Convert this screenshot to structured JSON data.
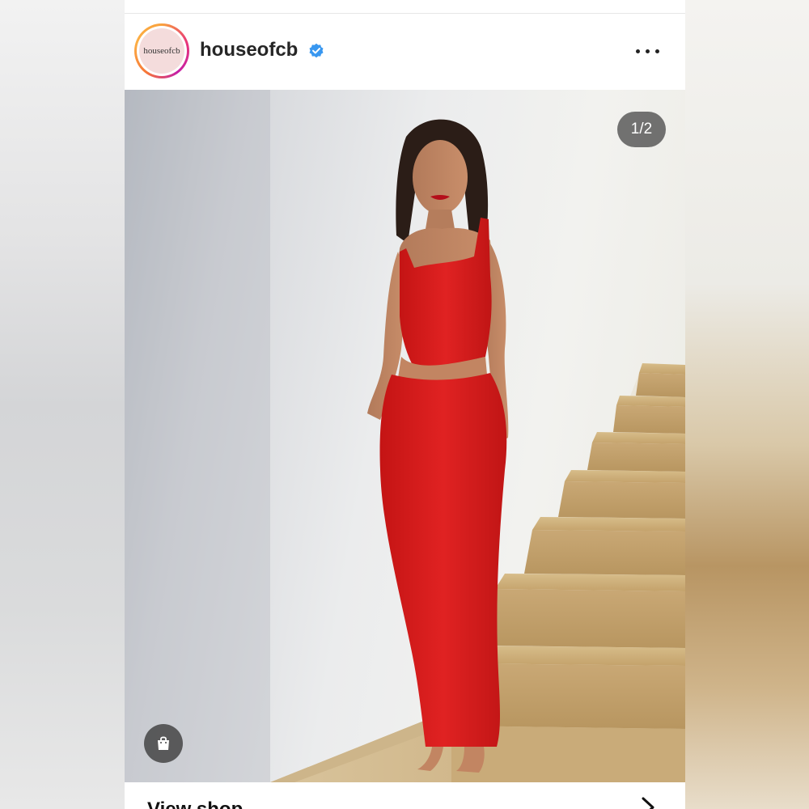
{
  "post": {
    "username": "houseofcb",
    "avatar_text": "houseofcb",
    "verified_icon": "verified-badge-icon",
    "more_icon": "more-options-icon",
    "image_counter": "1/2",
    "shop_icon": "shopping-bag-icon",
    "view_shop_label": "View shop",
    "chevron_icon": "chevron-right-icon"
  },
  "colors": {
    "verified_blue": "#3897f0",
    "dress_red": "#d81c1c"
  }
}
